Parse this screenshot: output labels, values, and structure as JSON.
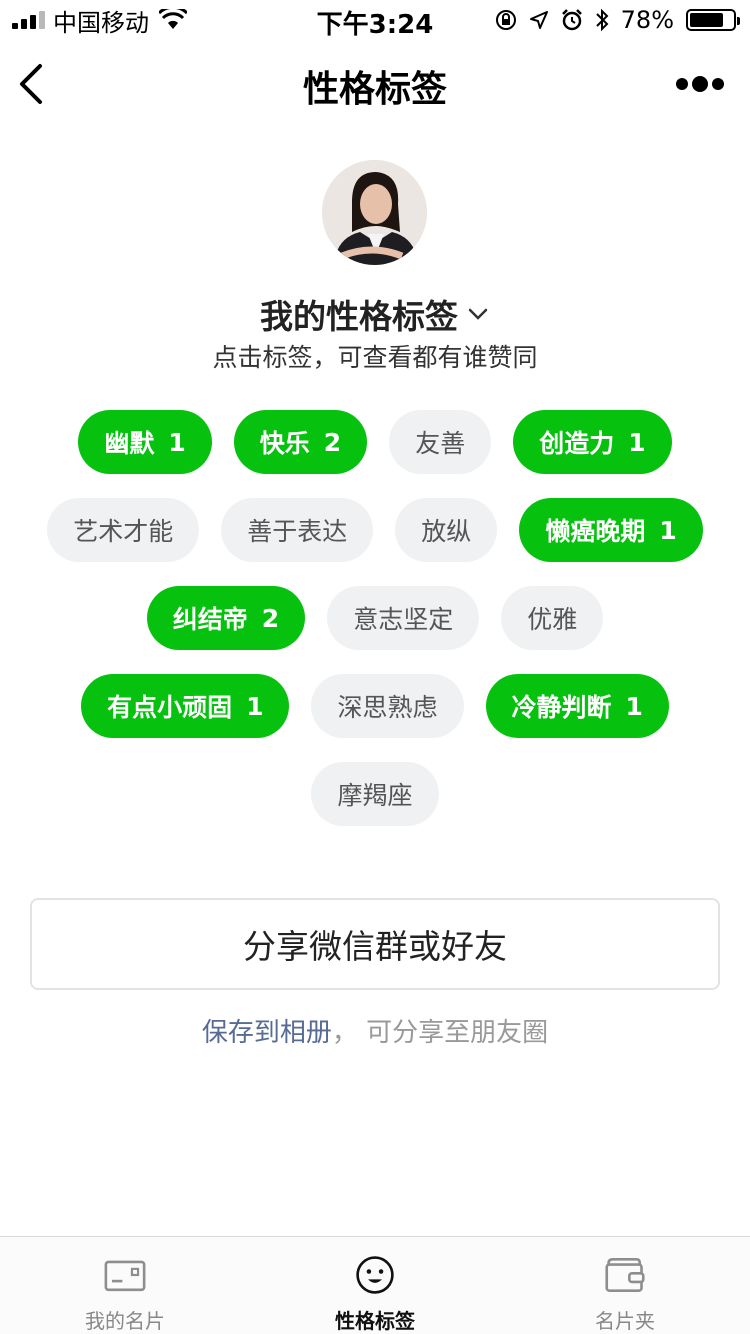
{
  "status_bar": {
    "carrier": "中国移动",
    "time": "下午3:24",
    "battery": "78%",
    "battery_level": 0.78
  },
  "nav": {
    "title": "性格标签"
  },
  "profile": {
    "section_title": "我的性格标签",
    "subtitle": "点击标签，可查看都有谁赞同"
  },
  "tag_rows": [
    [
      {
        "label": "幽默",
        "count": "1",
        "selected": true
      },
      {
        "label": "快乐",
        "count": "2",
        "selected": true
      },
      {
        "label": "友善",
        "count": "",
        "selected": false
      },
      {
        "label": "创造力",
        "count": "1",
        "selected": true
      }
    ],
    [
      {
        "label": "艺术才能",
        "count": "",
        "selected": false
      },
      {
        "label": "善于表达",
        "count": "",
        "selected": false
      },
      {
        "label": "放纵",
        "count": "",
        "selected": false
      },
      {
        "label": "懒癌晚期",
        "count": "1",
        "selected": true
      }
    ],
    [
      {
        "label": "纠结帝",
        "count": "2",
        "selected": true
      },
      {
        "label": "意志坚定",
        "count": "",
        "selected": false
      },
      {
        "label": "优雅",
        "count": "",
        "selected": false
      }
    ],
    [
      {
        "label": "有点小顽固",
        "count": "1",
        "selected": true
      },
      {
        "label": "深思熟虑",
        "count": "",
        "selected": false
      },
      {
        "label": "冷静判断",
        "count": "1",
        "selected": true
      }
    ],
    [
      {
        "label": "摩羯座",
        "count": "",
        "selected": false
      }
    ]
  ],
  "share": {
    "button_label": "分享微信群或好友",
    "save_link": "保存到相册",
    "save_sep": "，",
    "save_rest": "可分享至朋友圈"
  },
  "tabbar": {
    "items": [
      {
        "label": "我的名片",
        "icon": "card-icon",
        "active": false
      },
      {
        "label": "性格标签",
        "icon": "smiley-icon",
        "active": true
      },
      {
        "label": "名片夹",
        "icon": "wallet-icon",
        "active": false
      }
    ]
  },
  "colors": {
    "accent_green": "#07c10f",
    "link_blue": "#576b95",
    "tag_off_bg": "#f0f1f3"
  }
}
